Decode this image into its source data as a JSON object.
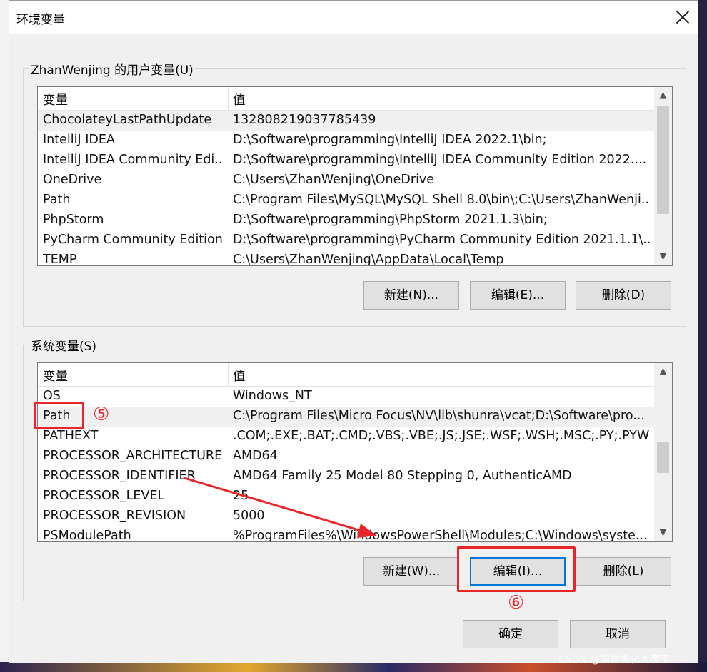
{
  "window": {
    "title": "环境变量"
  },
  "user_vars": {
    "group_label": "ZhanWenjing 的用户变量(U)",
    "headers": {
      "name": "变量",
      "value": "值"
    },
    "rows": [
      {
        "name": "ChocolateyLastPathUpdate",
        "value": "132808219037785439"
      },
      {
        "name": "IntelliJ IDEA",
        "value": "D:\\Software\\programming\\IntelliJ IDEA 2022.1\\bin;"
      },
      {
        "name": "IntelliJ IDEA Community Edi...",
        "value": "D:\\Software\\programming\\IntelliJ IDEA Community Edition 2022...."
      },
      {
        "name": "OneDrive",
        "value": "C:\\Users\\ZhanWenjing\\OneDrive"
      },
      {
        "name": "Path",
        "value": "C:\\Program Files\\MySQL\\MySQL Shell 8.0\\bin\\;C:\\Users\\ZhanWenji..."
      },
      {
        "name": "PhpStorm",
        "value": "D:\\Software\\programming\\PhpStorm 2021.1.3\\bin;"
      },
      {
        "name": "PyCharm Community Edition",
        "value": "D:\\Software\\programming\\PyCharm Community Edition 2021.1.1\\..."
      },
      {
        "name": "TEMP",
        "value": "C:\\Users\\ZhanWenjing\\AppData\\Local\\Temp"
      }
    ],
    "buttons": {
      "new": "新建(N)...",
      "edit": "编辑(E)...",
      "delete": "删除(D)"
    }
  },
  "system_vars": {
    "group_label": "系统变量(S)",
    "headers": {
      "name": "变量",
      "value": "值"
    },
    "rows": [
      {
        "name": "OS",
        "value": "Windows_NT"
      },
      {
        "name": "Path",
        "value": "C:\\Program Files\\Micro Focus\\NV\\lib\\shunra\\vcat;D:\\Software\\pro..."
      },
      {
        "name": "PATHEXT",
        "value": ".COM;.EXE;.BAT;.CMD;.VBS;.VBE;.JS;.JSE;.WSF;.WSH;.MSC;.PY;.PYW"
      },
      {
        "name": "PROCESSOR_ARCHITECTURE",
        "value": "AMD64"
      },
      {
        "name": "PROCESSOR_IDENTIFIER",
        "value": "AMD64 Family 25 Model 80 Stepping 0, AuthenticAMD"
      },
      {
        "name": "PROCESSOR_LEVEL",
        "value": "25"
      },
      {
        "name": "PROCESSOR_REVISION",
        "value": "5000"
      },
      {
        "name": "PSModulePath",
        "value": "%ProgramFiles%\\WindowsPowerShell\\Modules;C:\\Windows\\syste..."
      }
    ],
    "buttons": {
      "new": "新建(W)...",
      "edit": "编辑(I)...",
      "delete": "删除(L)"
    }
  },
  "footer": {
    "ok": "确定",
    "cancel": "取消"
  },
  "annotations": {
    "step5": "⑤",
    "step6": "⑥",
    "color": "#e8262a"
  },
  "watermark": "CSDN @混世黑化大魔王",
  "colors": {
    "focus": "#0078d7",
    "selected_row": "#f0f0f0",
    "button_face": "#e1e1e1"
  }
}
